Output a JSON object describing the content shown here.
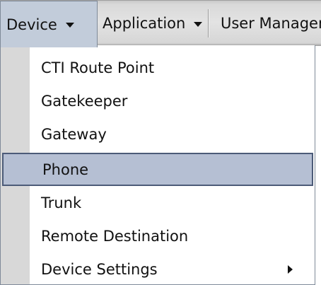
{
  "menubar": {
    "items": [
      {
        "label": "Device",
        "icon": "caret-down-icon"
      },
      {
        "label": "Application",
        "icon": "caret-down-icon"
      },
      {
        "label": "User Managem"
      }
    ]
  },
  "dropdown": {
    "items": [
      {
        "label": "CTI Route Point"
      },
      {
        "label": "Gatekeeper"
      },
      {
        "label": "Gateway"
      },
      {
        "label": "Phone",
        "selected": true
      },
      {
        "label": "Trunk"
      },
      {
        "label": "Remote Destination"
      },
      {
        "label": "Device Settings",
        "icon": "submenu-arrow-icon"
      }
    ]
  },
  "colors": {
    "menubar_bg": "#e0e0e0",
    "active_menu_bg": "#c2ccda",
    "selected_item_bg": "#b5bfd3",
    "selected_item_border": "#4c5b78",
    "gutter": "#d8d8d8"
  }
}
